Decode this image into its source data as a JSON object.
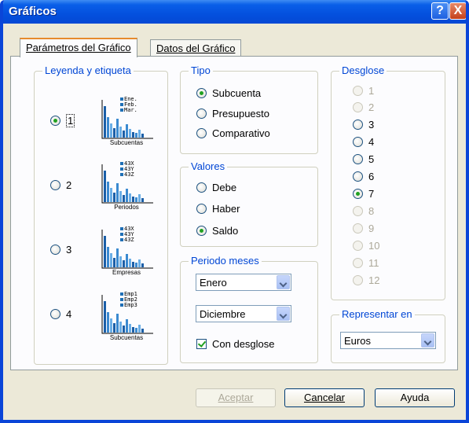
{
  "window": {
    "title": "Gráficos",
    "help_label": "?",
    "close_label": "X"
  },
  "tabs": [
    {
      "label": "Parámetros del Gráfico"
    },
    {
      "label": "Datos del Gráfico"
    }
  ],
  "legend_group": {
    "title": "Leyenda y etiqueta",
    "options": [
      {
        "label": "1",
        "selected": true,
        "legend": [
          "Ene.",
          "Feb.",
          "Mar."
        ],
        "caption": "Subcuentas"
      },
      {
        "label": "2",
        "selected": false,
        "legend": [
          "43X",
          "43Y",
          "43Z"
        ],
        "caption": "Periodos"
      },
      {
        "label": "3",
        "selected": false,
        "legend": [
          "43X",
          "43Y",
          "43Z"
        ],
        "caption": "Empresas"
      },
      {
        "label": "4",
        "selected": false,
        "legend": [
          "Emp1",
          "Emp2",
          "Emp3"
        ],
        "caption": "Subcuentas"
      }
    ]
  },
  "tipo_group": {
    "title": "Tipo",
    "options": [
      {
        "label": "Subcuenta",
        "selected": true
      },
      {
        "label": "Presupuesto",
        "selected": false
      },
      {
        "label": "Comparativo",
        "selected": false
      }
    ]
  },
  "valores_group": {
    "title": "Valores",
    "options": [
      {
        "label": "Debe",
        "selected": false
      },
      {
        "label": "Haber",
        "selected": false
      },
      {
        "label": "Saldo",
        "selected": true
      }
    ]
  },
  "periodo_group": {
    "title": "Periodo meses",
    "from": "Enero",
    "to": "Diciembre",
    "desglose_checkbox": "Con desglose",
    "desglose_checked": true
  },
  "desglose_group": {
    "title": "Desglose",
    "options": [
      {
        "label": "1",
        "enabled": false,
        "selected": false
      },
      {
        "label": "2",
        "enabled": false,
        "selected": false
      },
      {
        "label": "3",
        "enabled": true,
        "selected": false
      },
      {
        "label": "4",
        "enabled": true,
        "selected": false
      },
      {
        "label": "5",
        "enabled": true,
        "selected": false
      },
      {
        "label": "6",
        "enabled": true,
        "selected": false
      },
      {
        "label": "7",
        "enabled": true,
        "selected": true
      },
      {
        "label": "8",
        "enabled": false,
        "selected": false
      },
      {
        "label": "9",
        "enabled": false,
        "selected": false
      },
      {
        "label": "10",
        "enabled": false,
        "selected": false
      },
      {
        "label": "11",
        "enabled": false,
        "selected": false
      },
      {
        "label": "12",
        "enabled": false,
        "selected": false
      }
    ]
  },
  "representar_group": {
    "title": "Representar en",
    "value": "Euros"
  },
  "buttons": {
    "accept": "Aceptar",
    "cancel": "Cancelar",
    "help": "Ayuda"
  },
  "colors": {
    "accent": "#0046d5",
    "titlebar": "#0450de",
    "bar": "#1f6fb5"
  }
}
